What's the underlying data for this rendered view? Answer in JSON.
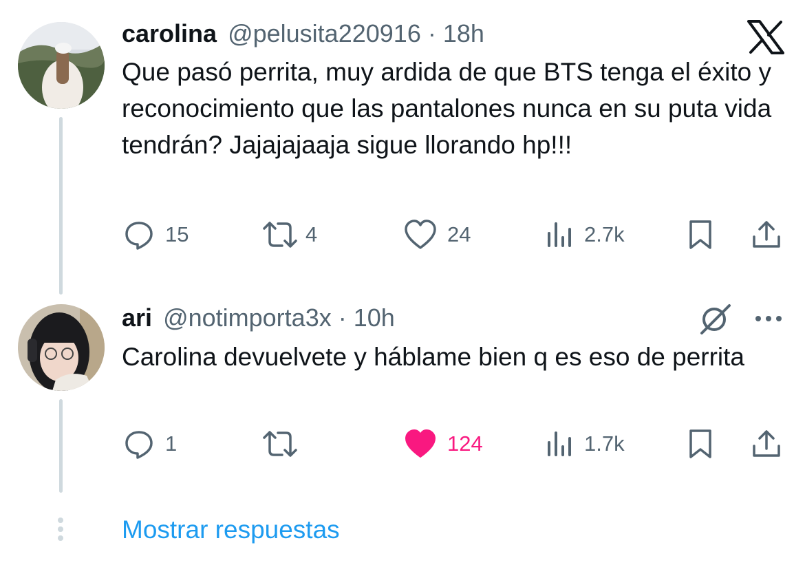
{
  "tweets": [
    {
      "name": "carolina",
      "handle": "@pelusita220916",
      "separator": "·",
      "time": "18h",
      "text": "Que pasó perrita, muy ardida de que BTS tenga el éxito y reconocimiento que las pantalones nunca en su puta vida tendrán? Jajajajaaja sigue llorando hp!!!",
      "replies": "15",
      "retweets": "4",
      "likes": "24",
      "views": "2.7k",
      "liked": false
    },
    {
      "name": "ari",
      "handle": "@notimporta3x",
      "separator": "·",
      "time": "10h",
      "text": "Carolina devuelvete y háblame bien q es eso de perrita",
      "replies": "1",
      "retweets": "",
      "likes": "124",
      "views": "1.7k",
      "liked": true
    }
  ],
  "show_replies_label": "Mostrar respuestas",
  "icons": {
    "brand": "x-logo-icon",
    "reply": "reply-icon",
    "retweet": "retweet-icon",
    "like": "heart-icon",
    "views": "views-icon",
    "bookmark": "bookmark-icon",
    "share": "share-icon",
    "grok": "grok-icon",
    "more": "more-icon"
  },
  "colors": {
    "text": "#0f1419",
    "secondary": "#536471",
    "link": "#1d9bf0",
    "like_active": "#f91880",
    "thread_line": "#cfd9de"
  }
}
